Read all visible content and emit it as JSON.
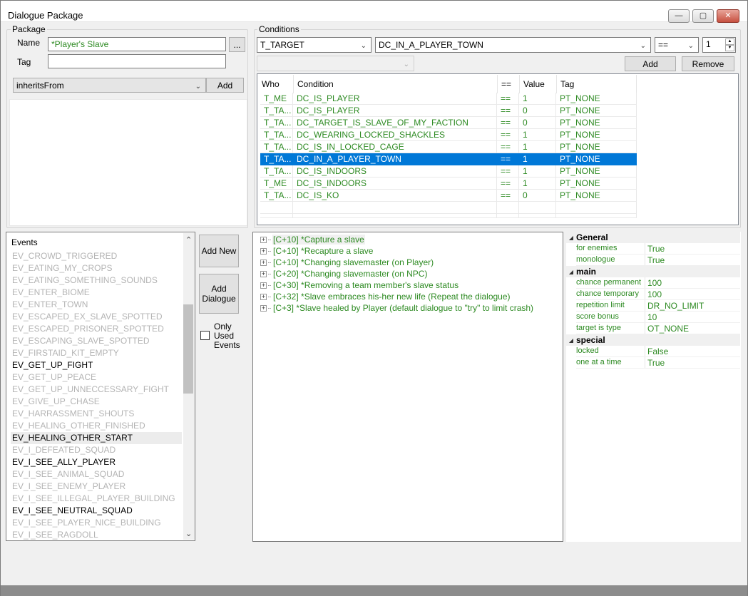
{
  "window": {
    "title": "Dialogue Package",
    "minimize_glyph": "—",
    "maximize_glyph": "▢",
    "close_glyph": "✕"
  },
  "package": {
    "group_label": "Package",
    "name_label": "Name",
    "name_value": "*Player's Slave",
    "browse_label": "...",
    "tag_label": "Tag",
    "tag_value": "",
    "inherits_value": "inheritsFrom",
    "add_label": "Add"
  },
  "conditions": {
    "group_label": "Conditions",
    "who_value": "T_TARGET",
    "condition_value": "DC_IN_A_PLAYER_TOWN",
    "operator_value": "==",
    "value_value": "1",
    "secondary_value": "",
    "add_label": "Add",
    "remove_label": "Remove",
    "columns": [
      "Who",
      "Condition",
      "==",
      "Value",
      "Tag"
    ],
    "rows": [
      {
        "who": "T_ME",
        "condition": "DC_IS_PLAYER",
        "op": "==",
        "value": "1",
        "tag": "PT_NONE"
      },
      {
        "who": "T_TA...",
        "condition": "DC_IS_PLAYER",
        "op": "==",
        "value": "0",
        "tag": "PT_NONE"
      },
      {
        "who": "T_TA...",
        "condition": "DC_TARGET_IS_SLAVE_OF_MY_FACTION",
        "op": "==",
        "value": "0",
        "tag": "PT_NONE"
      },
      {
        "who": "T_TA...",
        "condition": "DC_WEARING_LOCKED_SHACKLES",
        "op": "==",
        "value": "1",
        "tag": "PT_NONE"
      },
      {
        "who": "T_TA...",
        "condition": "DC_IS_IN_LOCKED_CAGE",
        "op": "==",
        "value": "1",
        "tag": "PT_NONE"
      },
      {
        "who": "T_TA...",
        "condition": "DC_IN_A_PLAYER_TOWN",
        "op": "==",
        "value": "1",
        "tag": "PT_NONE"
      },
      {
        "who": "T_TA...",
        "condition": "DC_IS_INDOORS",
        "op": "==",
        "value": "1",
        "tag": "PT_NONE"
      },
      {
        "who": "T_ME",
        "condition": "DC_IS_INDOORS",
        "op": "==",
        "value": "1",
        "tag": "PT_NONE"
      },
      {
        "who": "T_TA...",
        "condition": "DC_IS_KO",
        "op": "==",
        "value": "0",
        "tag": "PT_NONE"
      }
    ],
    "selected_row": 5
  },
  "events": {
    "header": "Events",
    "items": [
      {
        "label": "EV_CROWD_TRIGGERED",
        "active": false
      },
      {
        "label": "EV_EATING_MY_CROPS",
        "active": false
      },
      {
        "label": "EV_EATING_SOMETHING_SOUNDS",
        "active": false
      },
      {
        "label": "EV_ENTER_BIOME",
        "active": false
      },
      {
        "label": "EV_ENTER_TOWN",
        "active": false
      },
      {
        "label": "EV_ESCAPED_EX_SLAVE_SPOTTED",
        "active": false
      },
      {
        "label": "EV_ESCAPED_PRISONER_SPOTTED",
        "active": false
      },
      {
        "label": "EV_ESCAPING_SLAVE_SPOTTED",
        "active": false
      },
      {
        "label": "EV_FIRSTAID_KIT_EMPTY",
        "active": false
      },
      {
        "label": "EV_GET_UP_FIGHT",
        "active": true
      },
      {
        "label": "EV_GET_UP_PEACE",
        "active": false
      },
      {
        "label": "EV_GET_UP_UNNECCESSARY_FIGHT",
        "active": false
      },
      {
        "label": "EV_GIVE_UP_CHASE",
        "active": false
      },
      {
        "label": "EV_HARRASSMENT_SHOUTS",
        "active": false
      },
      {
        "label": "EV_HEALING_OTHER_FINISHED",
        "active": false
      },
      {
        "label": "EV_HEALING_OTHER_START",
        "active": true,
        "highlighted": true
      },
      {
        "label": "EV_I_DEFEATED_SQUAD",
        "active": false
      },
      {
        "label": "EV_I_SEE_ALLY_PLAYER",
        "active": true
      },
      {
        "label": "EV_I_SEE_ANIMAL_SQUAD",
        "active": false
      },
      {
        "label": "EV_I_SEE_ENEMY_PLAYER",
        "active": false
      },
      {
        "label": "EV_I_SEE_ILLEGAL_PLAYER_BUILDING",
        "active": false
      },
      {
        "label": "EV_I_SEE_NEUTRAL_SQUAD",
        "active": true
      },
      {
        "label": "EV_I_SEE_PLAYER_NICE_BUILDING",
        "active": false
      },
      {
        "label": "EV_I_SEE_RAGDOLL",
        "active": false
      }
    ]
  },
  "actions": {
    "add_new_label": "Add New",
    "add_dialogue_label": "Add\nDialogue",
    "only_used_label": "Only\nUsed\nEvents",
    "only_used_checked": false
  },
  "dialogues": [
    "[C+10] *Capture a slave",
    "[C+10] *Recapture a slave",
    "[C+10] *Changing slavemaster (on Player)",
    "[C+20] *Changing slavemaster (on NPC)",
    "[C+30] *Removing a team member's slave status",
    "[C+32] *Slave embraces his-her new life (Repeat the dialogue)",
    "[C+3] *Slave healed by Player (default dialogue to \"try\" to limit crash)"
  ],
  "properties": {
    "categories": [
      {
        "name": "General",
        "rows": [
          {
            "key": "for enemies",
            "value": "True"
          },
          {
            "key": "monologue",
            "value": "True"
          }
        ]
      },
      {
        "name": "main",
        "rows": [
          {
            "key": "chance permanent",
            "value": "100"
          },
          {
            "key": "chance temporary",
            "value": "100"
          },
          {
            "key": "repetition limit",
            "value": "DR_NO_LIMIT"
          },
          {
            "key": "score bonus",
            "value": "10"
          },
          {
            "key": "target is type",
            "value": "OT_NONE"
          }
        ]
      },
      {
        "name": "special",
        "rows": [
          {
            "key": "locked",
            "value": "False"
          },
          {
            "key": "one at a time",
            "value": "True"
          }
        ]
      }
    ],
    "collapse_glyph": "◢"
  }
}
